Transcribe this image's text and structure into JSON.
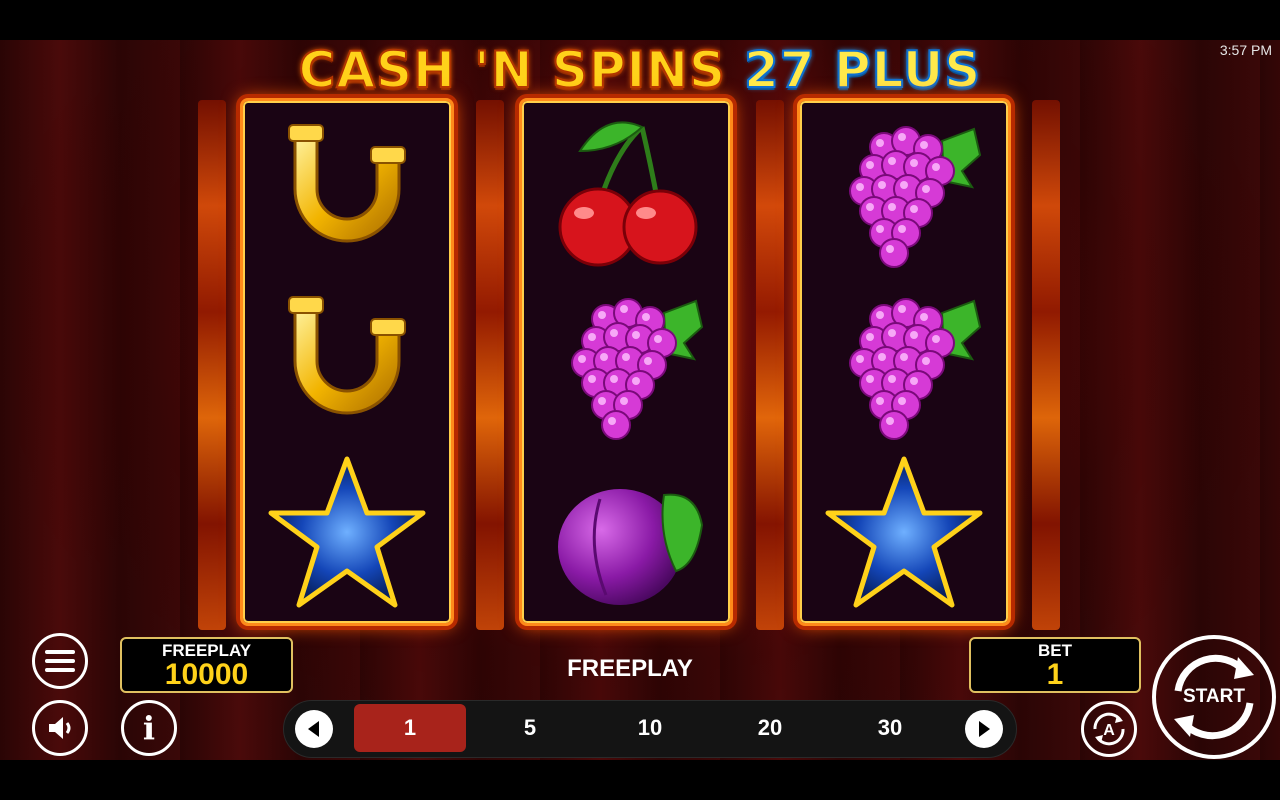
{
  "status_bar": {
    "time": "3:57 PM"
  },
  "title": {
    "part1": "CASH 'N SPINS",
    "part2": "27 PLUS"
  },
  "reels": [
    [
      "horseshoe",
      "horseshoe",
      "blue-star"
    ],
    [
      "cherry",
      "grapes",
      "plum"
    ],
    [
      "grapes",
      "grapes",
      "blue-star"
    ]
  ],
  "balance": {
    "label": "FREEPLAY",
    "value": "10000"
  },
  "mode_label": "FREEPLAY",
  "bet": {
    "label": "BET",
    "value": "1"
  },
  "bet_options": [
    "1",
    "5",
    "10",
    "20",
    "30"
  ],
  "selected_bet": "1",
  "start_label": "START",
  "autoplay_letter": "A",
  "info_letter": "i",
  "colors": {
    "accent_gold": "#ffd21a",
    "active_bet": "#a8231b",
    "reel_border": "#ff8a1a"
  }
}
